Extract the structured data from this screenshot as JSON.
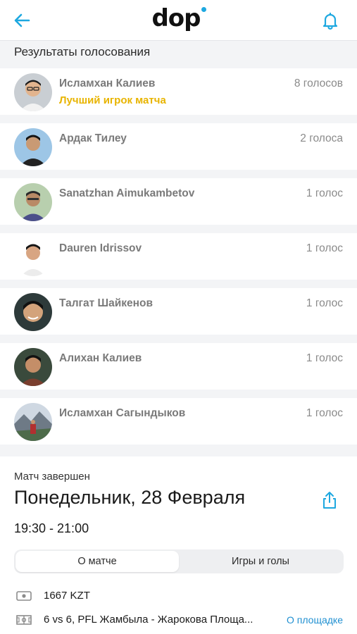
{
  "header": {
    "logo_text": "dop",
    "back_icon": "arrow-left-icon",
    "bell_icon": "bell-icon",
    "accent_color": "#1ea8e0"
  },
  "results": {
    "title": "Результаты голосования",
    "best_player_color": "#e8b400",
    "items": [
      {
        "name": "Исламхан Калиев",
        "votes": "8 голосов",
        "badge": "Лучший игрок матча",
        "avatar": "player-photo"
      },
      {
        "name": "Ардак Тилеу",
        "votes": "2 голоса",
        "avatar": "player-photo"
      },
      {
        "name": "Sanatzhan Aimukambetov",
        "votes": "1 голос",
        "avatar": "player-photo"
      },
      {
        "name": "Dauren Idrissov",
        "votes": "1 голос",
        "avatar": "player-photo"
      },
      {
        "name": "Талгат Шайкенов",
        "votes": "1 голос",
        "avatar": "player-photo"
      },
      {
        "name": "Алихан Калиев",
        "votes": "1 голос",
        "avatar": "player-photo"
      },
      {
        "name": "Исламхан Сагындыков",
        "votes": "1 голос",
        "avatar": "player-photo"
      }
    ]
  },
  "match": {
    "status": "Матч завершен",
    "date": "Понедельник, 28 Февраля",
    "time": "19:30 - 21:00",
    "share_icon": "share-icon",
    "tabs": [
      {
        "label": "О матче",
        "active": true
      },
      {
        "label": "Игры и голы",
        "active": false
      }
    ],
    "price": {
      "icon": "money-icon",
      "text": "1667 KZT"
    },
    "venue": {
      "icon": "field-icon",
      "text": "6 vs 6, PFL Жамбыла - Жарокова Площа...",
      "link": "О площадке"
    }
  }
}
